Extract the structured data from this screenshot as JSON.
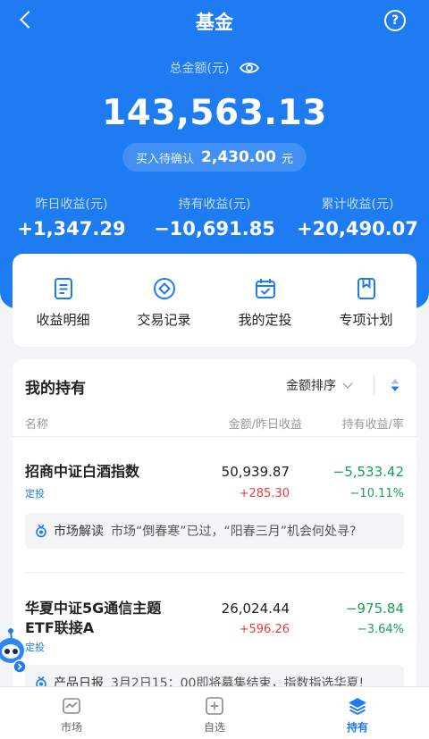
{
  "header": {
    "title": "基金",
    "help_label": "?"
  },
  "summary": {
    "total_label": "总金额(元)",
    "total_value": "143,563.13",
    "pending_label": "买入待确认",
    "pending_value": "2,430.00",
    "pending_unit": "元"
  },
  "stats": [
    {
      "label": "昨日收益(元)",
      "value": "+1,347.29"
    },
    {
      "label": "持有收益(元)",
      "value": "−10,691.85"
    },
    {
      "label": "累计收益(元)",
      "value": "+20,490.07"
    }
  ],
  "quick_actions": [
    {
      "label": "收益明细",
      "icon": "document-icon"
    },
    {
      "label": "交易记录",
      "icon": "diamond-circle-icon"
    },
    {
      "label": "我的定投",
      "icon": "calendar-check-icon"
    },
    {
      "label": "专项计划",
      "icon": "bookmark-icon"
    }
  ],
  "holdings": {
    "title": "我的持有",
    "sort_label": "金额排序",
    "columns": {
      "name": "名称",
      "amount": "金额/昨日收益",
      "profit": "持有收益/率"
    },
    "funds": [
      {
        "name": "招商中证白酒指数",
        "tag": "定投",
        "amount": "50,939.87",
        "yesterday": "+285.30",
        "profit": "−5,533.42",
        "rate": "−10.11%",
        "tip_kind": "市场解读",
        "tip_text": "市场“倒春寒”已过，“阳春三月”机会何处寻?"
      },
      {
        "name_line1": "华夏中证5G通信主题",
        "name_line2": "ETF联接A",
        "tag": "定投",
        "amount": "26,024.44",
        "yesterday": "+596.26",
        "profit": "−975.84",
        "rate": "−3.64%",
        "tip_kind": "产品日报",
        "tip_text": "3月2日15：00即将募集结束，指数指选华夏!"
      }
    ]
  },
  "tabbar": [
    {
      "label": "市场",
      "icon": "market-icon"
    },
    {
      "label": "自选",
      "icon": "add-square-icon"
    },
    {
      "label": "持有",
      "icon": "layers-icon"
    }
  ],
  "colors": {
    "brand": "#1f7bf2",
    "up": "#e63c3c",
    "down": "#1a9e56"
  }
}
